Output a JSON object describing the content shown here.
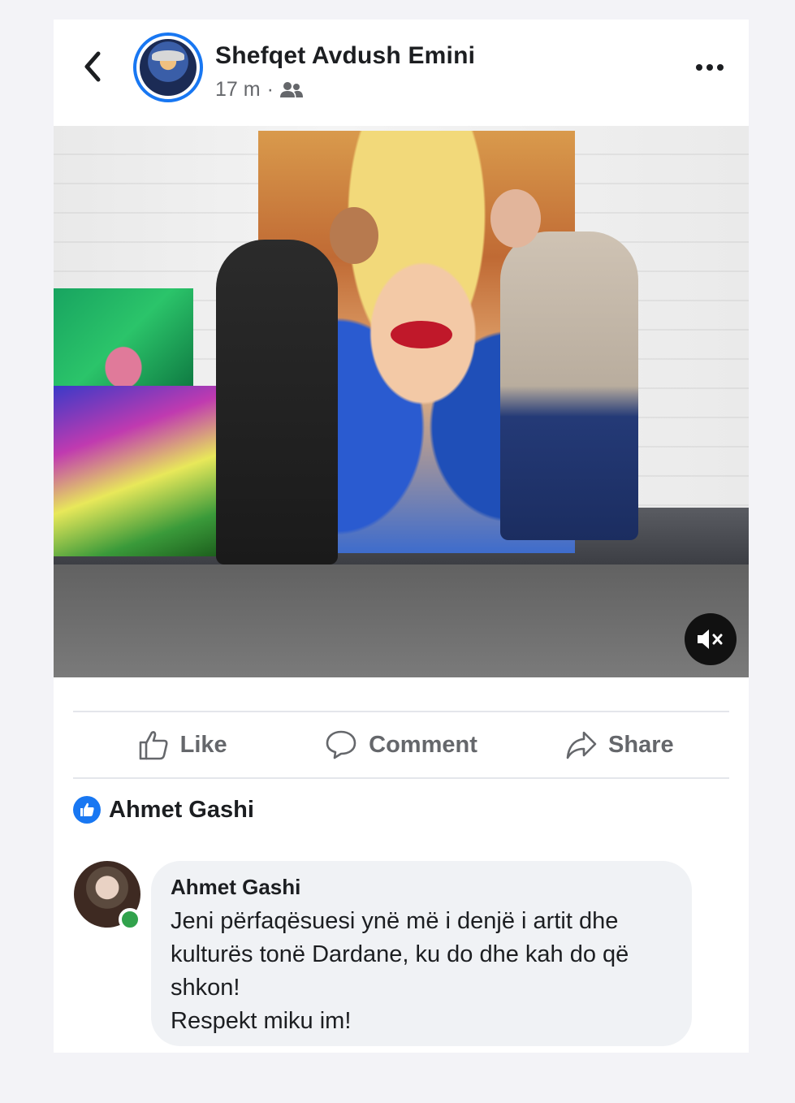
{
  "post": {
    "author": "Shefqet Avdush Emini",
    "time": "17 m",
    "separator": "·",
    "audience_icon": "friends-icon",
    "more_icon": "more-horizontal-icon",
    "back_icon": "back-chevron-icon"
  },
  "media": {
    "type": "video",
    "mute_icon": "volume-muted-icon"
  },
  "actions": {
    "like_label": "Like",
    "comment_label": "Comment",
    "share_label": "Share"
  },
  "reactions": {
    "liked_by": "Ahmet Gashi"
  },
  "comment": {
    "author": "Ahmet Gashi",
    "text": "Jeni përfaqësuesi ynë më i denjë i artit dhe\nkulturës tonë Dardane, ku do dhe kah do që\nshkon!\nRespekt miku im!",
    "online": true
  },
  "colors": {
    "accent": "#1877f2",
    "online": "#31a24c",
    "secondary_text": "#65676b",
    "bubble": "#f0f2f5"
  }
}
